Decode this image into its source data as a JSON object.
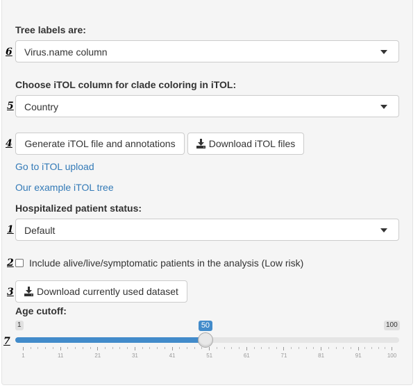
{
  "tree_labels": {
    "marker": "6",
    "label": "Tree labels are:",
    "selected": "Virus.name column"
  },
  "clade_coloring": {
    "marker": "5",
    "label": "Choose iTOL column for clade coloring in iTOL:",
    "selected": "Country"
  },
  "itol_actions": {
    "marker": "4",
    "generate_label": "Generate iTOL file and annotations",
    "download_label": "Download iTOL files"
  },
  "links": {
    "upload": "Go to iTOL upload",
    "example": "Our example iTOL tree"
  },
  "hospitalized": {
    "marker": "1",
    "label": "Hospitalized patient status:",
    "selected": "Default"
  },
  "low_risk": {
    "marker": "2",
    "label": "Include alive/live/symptomatic patients in the analysis (Low risk)",
    "checked": false
  },
  "dataset_download": {
    "marker": "3",
    "label": "Download currently used dataset"
  },
  "age_cutoff": {
    "marker": "7",
    "label": "Age cutoff:",
    "min": 1,
    "max": 100,
    "value": 50,
    "min_label": "1",
    "max_label": "100",
    "value_label": "50",
    "ticks": [
      "1",
      "11",
      "21",
      "31",
      "41",
      "51",
      "61",
      "71",
      "81",
      "91",
      "100"
    ]
  },
  "colors": {
    "accent": "#428bca",
    "link": "#337ab7"
  }
}
